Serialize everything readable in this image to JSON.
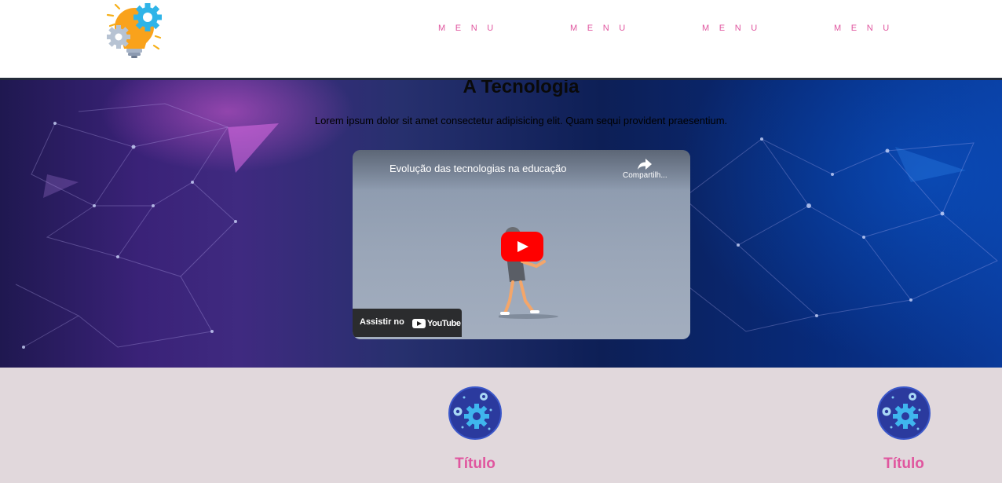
{
  "header": {
    "logo_icon": "lightbulb-gears-icon",
    "nav": [
      {
        "label": "Menu"
      },
      {
        "label": "Menu"
      },
      {
        "label": "Menu"
      },
      {
        "label": "Menu"
      }
    ]
  },
  "hero": {
    "title": "A Tecnologia",
    "subtitle": "Lorem ipsum dolor sit amet consectetur adipisicing elit. Quam sequi provident praesentium.",
    "video": {
      "title": "Evolução das tecnologias na educação",
      "share_label": "Compartilh...",
      "watch_label": "Assistir no",
      "platform": "YouTube"
    }
  },
  "features": [
    {
      "title": "Título",
      "icon": "gears-sphere-icon"
    },
    {
      "title": "Título",
      "icon": "gears-sphere-icon"
    }
  ],
  "colors": {
    "accent": "#e0569f",
    "header_border": "#232b3a",
    "features_bg": "#e1d8dc",
    "play_red": "#ff0000"
  }
}
